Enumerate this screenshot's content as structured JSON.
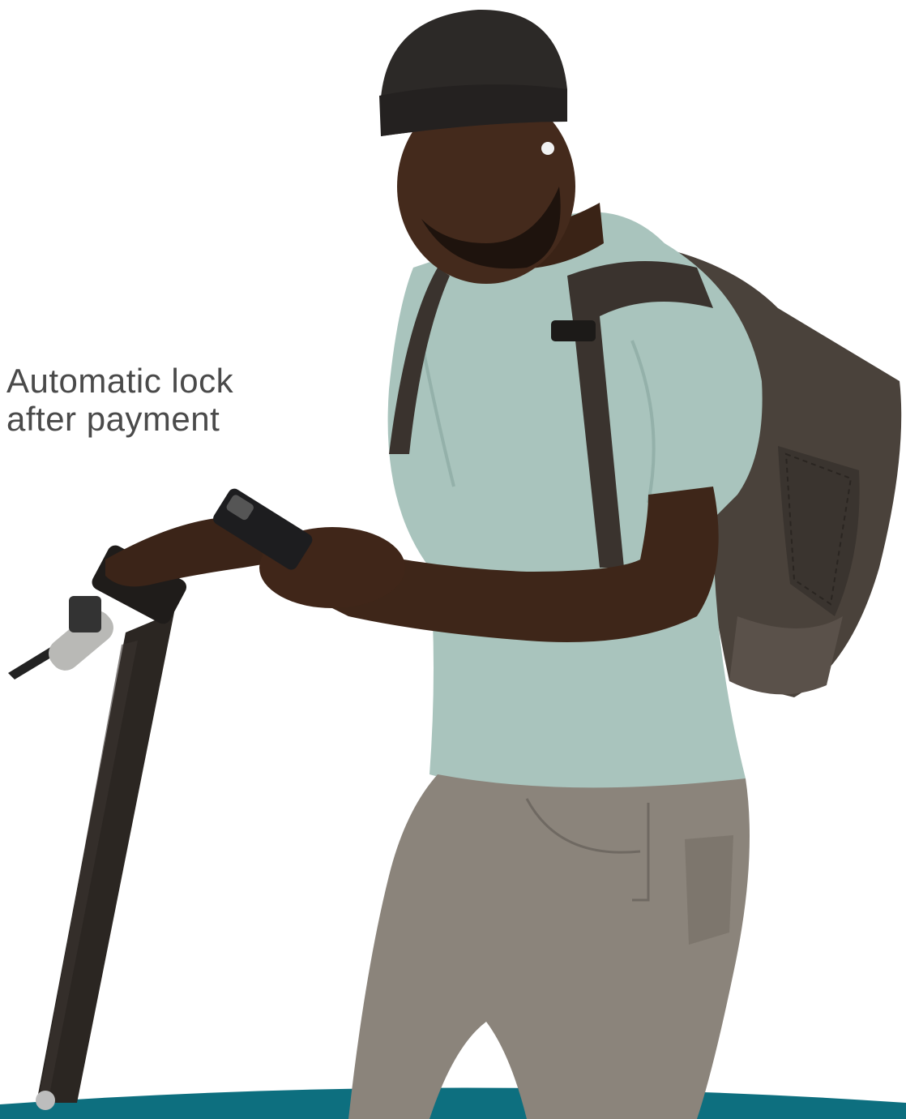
{
  "caption": {
    "line1": "Automatic lock",
    "line2": "after payment"
  },
  "colors": {
    "background": "#ffffff",
    "text": "#4a4a4a",
    "bottom_band": "#0d6f7f"
  }
}
